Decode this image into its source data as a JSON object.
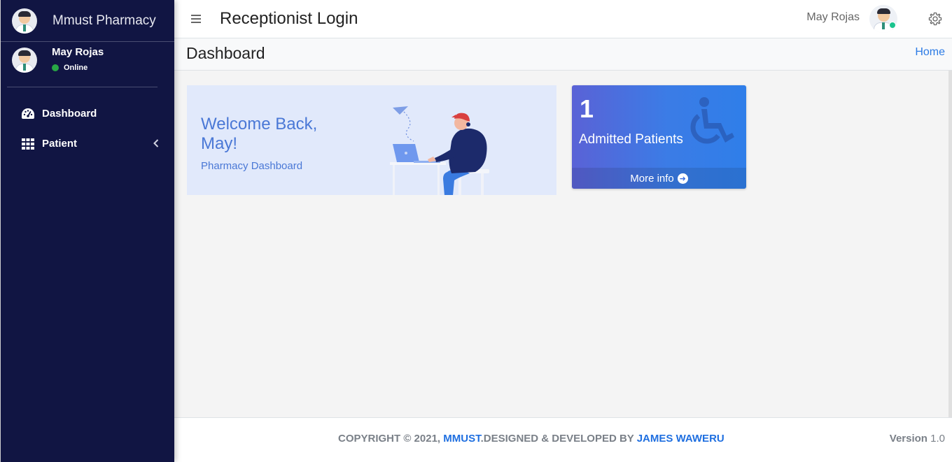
{
  "sidebar": {
    "brand": "Mmust Pharmacy",
    "user_name": "May Rojas",
    "user_status": "Online",
    "items": [
      {
        "label": "Dashboard",
        "icon": "tachometer-icon"
      },
      {
        "label": "Patient",
        "icon": "grid-icon",
        "has_submenu": true
      }
    ]
  },
  "topbar": {
    "title": "Receptionist Login",
    "user_name": "May Rojas"
  },
  "content_header": {
    "title": "Dashboard",
    "breadcrumb": "Home"
  },
  "welcome": {
    "line1": "Welcome Back,",
    "line2": "May!",
    "subtitle": "Pharmacy Dashboard"
  },
  "info_box": {
    "count": "1",
    "label": "Admitted Patients",
    "footer": "More info",
    "icon": "wheelchair-icon"
  },
  "footer": {
    "copyright_prefix": "COPYRIGHT © 2021,",
    "org": "MMUST",
    "designed": ".DESIGNED & DEVELOPED BY",
    "author": "JAMES WAWERU",
    "version_label": "Version",
    "version_value": "1.0"
  },
  "colors": {
    "sidebar_bg": "#111543",
    "accent_blue": "#2c7be5",
    "online_green": "#28a745"
  }
}
